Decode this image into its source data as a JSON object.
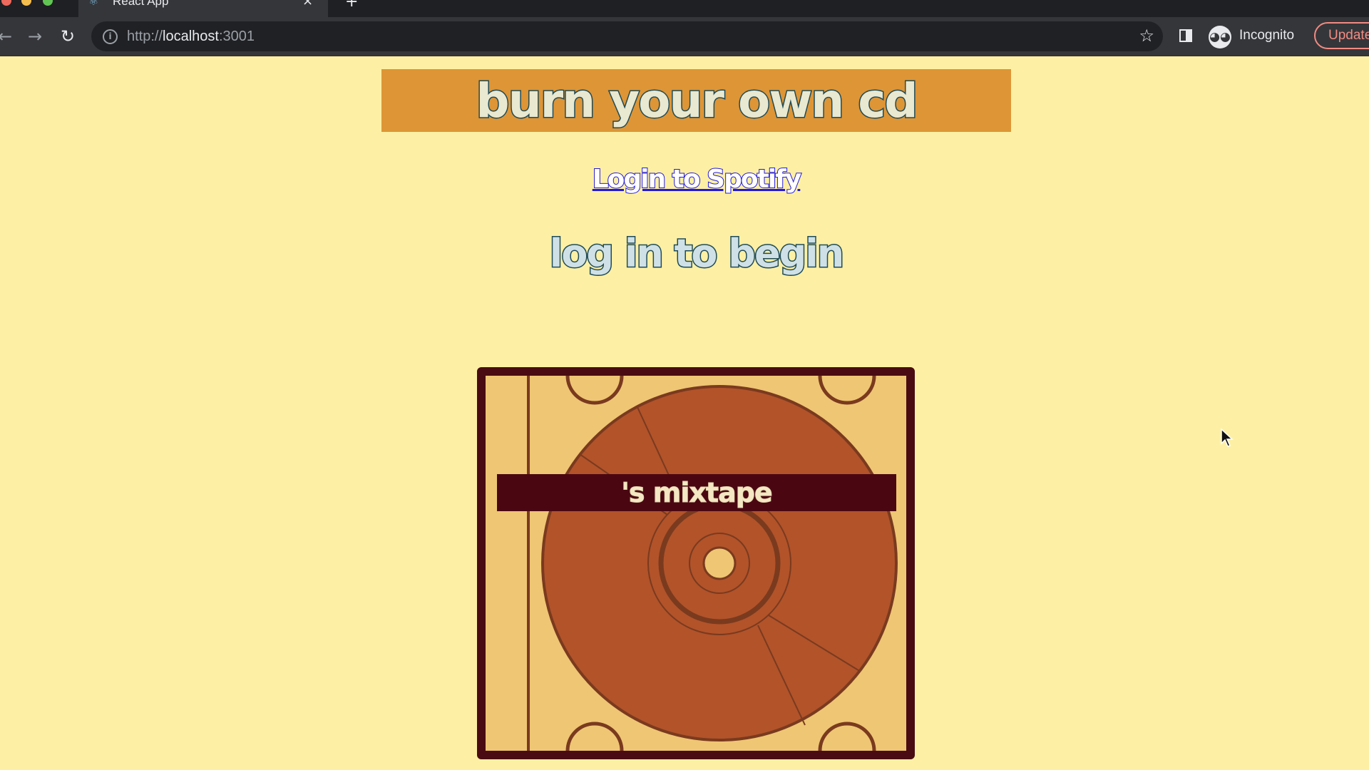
{
  "browser": {
    "tab_title": "React App",
    "tab_close": "×",
    "new_tab": "+",
    "url_scheme": "http://",
    "url_host": "localhost",
    "url_port": ":3001",
    "profile_label": "Incognito",
    "update_label": "Update"
  },
  "header": {
    "title": "burn your own cd"
  },
  "auth": {
    "login_link": "Login to Spotify",
    "status": "log in to begin"
  },
  "cd": {
    "label": "'s mixtape"
  },
  "colors": {
    "page_background": "#fdf0a4",
    "banner": "#de9535",
    "title_outline": "#1f4a55",
    "case_frame": "#4a0c12",
    "case_fill": "#efc674",
    "disc": "#b2532a",
    "label_bar": "#4a0712",
    "link": "#2319d6"
  }
}
